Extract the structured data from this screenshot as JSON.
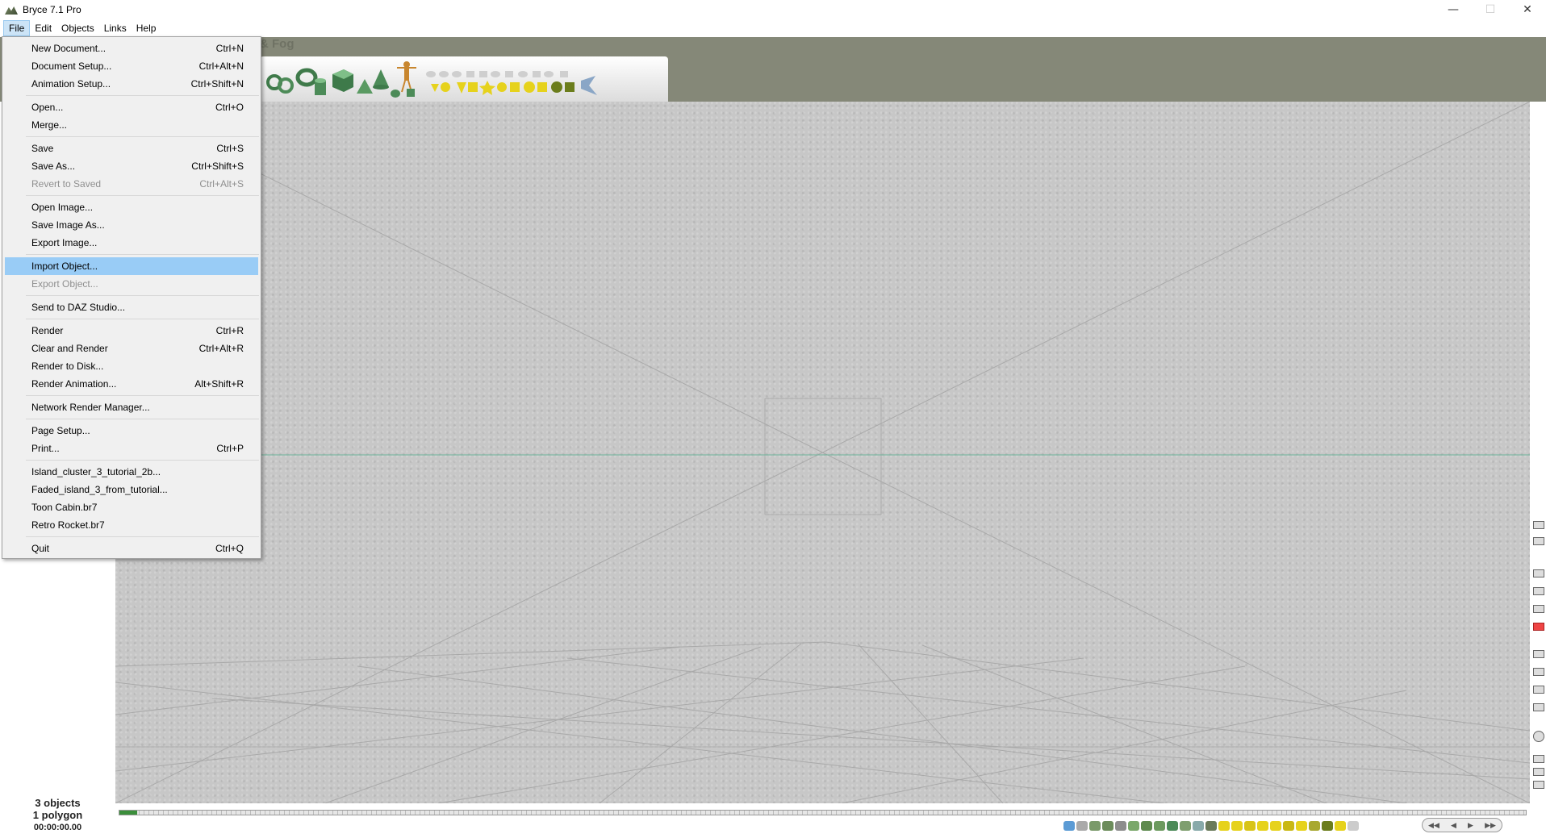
{
  "window": {
    "title": "Bryce 7.1 Pro",
    "controls": {
      "minimize": "—",
      "maximize": "☐",
      "close": "✕"
    }
  },
  "menubar": {
    "items": [
      "File",
      "Edit",
      "Objects",
      "Links",
      "Help"
    ],
    "active": "File"
  },
  "workspace": {
    "tab_ghost_text": "& Fog",
    "status": {
      "objects": "3 objects",
      "polygons": "1 polygon",
      "time": "00:00:00.00"
    }
  },
  "file_menu": {
    "items": [
      {
        "label": "New Document...",
        "shortcut": "Ctrl+N"
      },
      {
        "label": "Document Setup...",
        "shortcut": "Ctrl+Alt+N"
      },
      {
        "label": "Animation Setup...",
        "shortcut": "Ctrl+Shift+N"
      },
      {
        "label": "Open...",
        "shortcut": "Ctrl+O"
      },
      {
        "label": "Merge...",
        "shortcut": ""
      },
      {
        "label": "Save",
        "shortcut": "Ctrl+S"
      },
      {
        "label": "Save As...",
        "shortcut": "Ctrl+Shift+S"
      },
      {
        "label": "Revert to Saved",
        "shortcut": "Ctrl+Alt+S",
        "disabled": true
      },
      {
        "label": "Open Image...",
        "shortcut": ""
      },
      {
        "label": "Save Image As...",
        "shortcut": ""
      },
      {
        "label": "Export Image...",
        "shortcut": ""
      },
      {
        "label": "Import Object...",
        "shortcut": "",
        "highlighted": true
      },
      {
        "label": "Export Object...",
        "shortcut": "",
        "disabled": true
      },
      {
        "label": "Send to DAZ Studio...",
        "shortcut": ""
      },
      {
        "label": "Render",
        "shortcut": "Ctrl+R"
      },
      {
        "label": "Clear and Render",
        "shortcut": "Ctrl+Alt+R"
      },
      {
        "label": "Render to Disk...",
        "shortcut": ""
      },
      {
        "label": "Render Animation...",
        "shortcut": "Alt+Shift+R"
      },
      {
        "label": "Network Render Manager...",
        "shortcut": ""
      },
      {
        "label": "Page Setup...",
        "shortcut": ""
      },
      {
        "label": "Print...",
        "shortcut": "Ctrl+P"
      },
      {
        "label": "Island_cluster_3_tutorial_2b...",
        "shortcut": ""
      },
      {
        "label": "Faded_island_3_from_tutorial...",
        "shortcut": ""
      },
      {
        "label": "Toon Cabin.br7",
        "shortcut": ""
      },
      {
        "label": "Retro Rocket.br7",
        "shortcut": ""
      },
      {
        "label": "Quit",
        "shortcut": "Ctrl+Q"
      }
    ]
  },
  "icons": {
    "app": "bryce-mountain-icon",
    "primitives": [
      "torus-icon",
      "cylinder-icon",
      "cube-icon",
      "pyramid-icon",
      "cone-icon",
      "figure-icon",
      "sphere-icon",
      "star-icon",
      "lattice-icon",
      "vector-plane-icon"
    ]
  },
  "colors": {
    "highlight": "#99ccf6",
    "menu_bg": "#f0f0f0",
    "workspace_strip": "#858878",
    "viewport": "#c7c7c7",
    "horizon_line": "#6fb59c",
    "timeline_cursor": "#3b8e3b"
  }
}
